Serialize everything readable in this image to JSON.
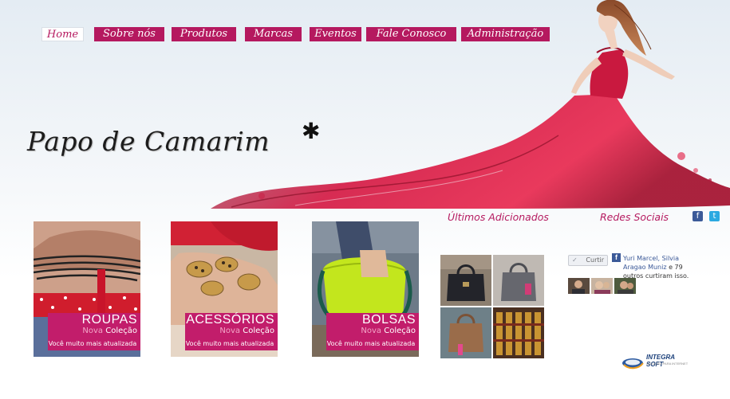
{
  "nav": {
    "items": [
      {
        "label": "Home"
      },
      {
        "label": "Sobre nós"
      },
      {
        "label": "Produtos"
      },
      {
        "label": "Marcas"
      },
      {
        "label": "Eventos"
      },
      {
        "label": "Fale Conosco"
      },
      {
        "label": "Administração"
      }
    ]
  },
  "site": {
    "title": "Papo de Camarim",
    "star": "✱"
  },
  "sections": {
    "latest": "Últimos Adicionados",
    "social": "Redes Sociais"
  },
  "social_icons": [
    "facebook-icon",
    "twitter-icon"
  ],
  "cards": [
    {
      "title": "ROUPAS",
      "nova": "Nova",
      "colecao": "Coleção",
      "desc": "Você muito mais atualizada"
    },
    {
      "title": "ACESSÓRIOS",
      "nova": "Nova",
      "colecao": "Coleção",
      "desc": "Você muito mais atualizada"
    },
    {
      "title": "BOLSAS",
      "nova": "Nova",
      "colecao": "Coleção",
      "desc": "Você muito mais atualizada"
    }
  ],
  "facebook": {
    "like_label": "Curtir",
    "names": "Yuri Marcel, Silvia Aragao Muniz",
    "rest": " e 79 outros curtiram isso."
  },
  "footer": {
    "logo_text": "INTEGRA SOFT",
    "logo_sub": "SOLUÇÃO PARA INTERNET"
  },
  "colors": {
    "brand": "#b5195f",
    "card_label": "#c21d6b",
    "facebook": "#3b5998"
  }
}
